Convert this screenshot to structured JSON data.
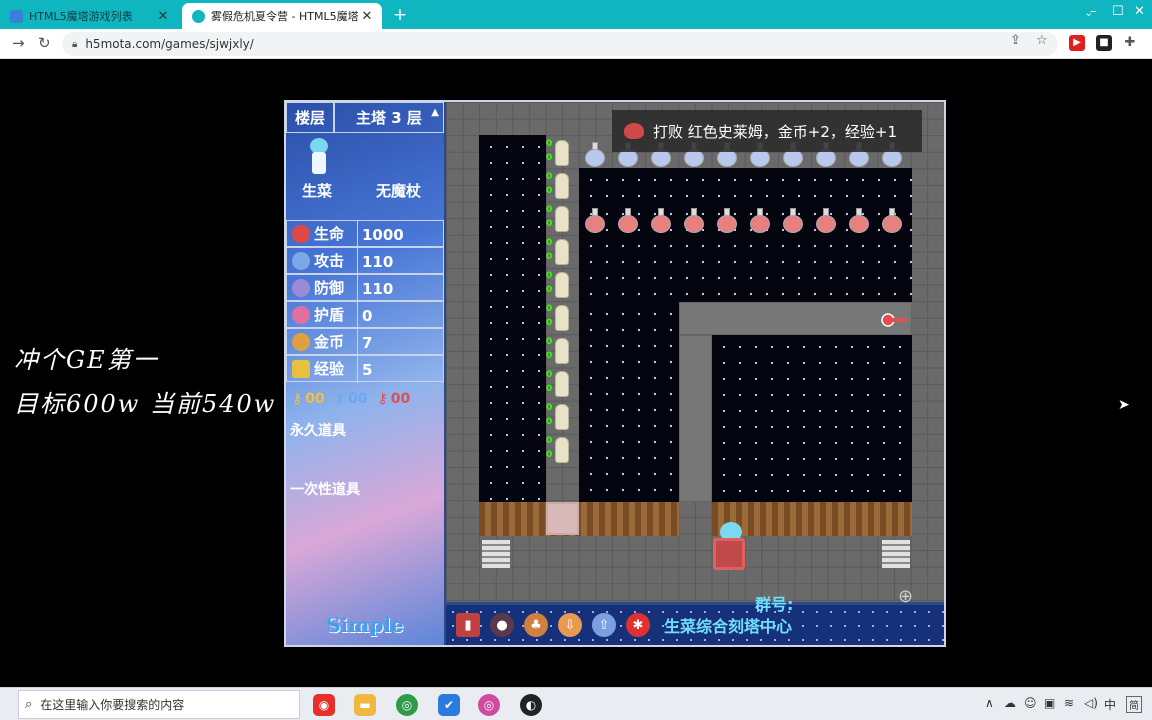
{
  "browser": {
    "tabs": [
      {
        "title": "HTML5魔塔游戏列表",
        "active": false
      },
      {
        "title": "雾假危机夏令营 - HTML5魔塔",
        "active": true
      }
    ],
    "url": "h5mota.com/games/sjwjxly/"
  },
  "overlay_text": {
    "line1": "冲个GE第一",
    "line2": "目标600w 当前540w"
  },
  "panel": {
    "floor_label": "楼层",
    "floor_value": "主塔 3 层",
    "hero_name": "生菜",
    "hero_weapon": "无魔杖",
    "stats": [
      {
        "label": "生命",
        "value": "1000",
        "icon": "heart-icon",
        "color": "#e04848"
      },
      {
        "label": "攻击",
        "value": "110",
        "icon": "sword-icon",
        "color": "#7aa8e8"
      },
      {
        "label": "防御",
        "value": "110",
        "icon": "shield-icon",
        "color": "#9a8ad8"
      },
      {
        "label": "护盾",
        "value": "0",
        "icon": "barrier-icon",
        "color": "#e070a0"
      },
      {
        "label": "金币",
        "value": "7",
        "icon": "coin-icon",
        "color": "#e0a040"
      },
      {
        "label": "经验",
        "value": "5",
        "icon": "exp-icon",
        "color": "#e8c040"
      }
    ],
    "keys": [
      {
        "count": "00",
        "color": "#f0c040",
        "icon": "yellow-key-icon"
      },
      {
        "count": "00",
        "color": "#6aa8f0",
        "icon": "blue-key-icon"
      },
      {
        "count": "00",
        "color": "#e05050",
        "icon": "red-key-icon"
      }
    ],
    "permanent_items_label": "永久道具",
    "consumable_items_label": "一次性道具",
    "mode_label": "Simple"
  },
  "map": {
    "toast": "打败 红色史莱姆，金币+2，经验+1",
    "mummy_damage": [
      "0",
      "0",
      "0",
      "0",
      "0",
      "0",
      "0",
      "0",
      "0",
      "0"
    ]
  },
  "toolbar": {
    "tools": [
      {
        "icon": "book-icon",
        "color": "#c04040",
        "glyph": "▮"
      },
      {
        "icon": "bag-icon",
        "color": "#5a3a4a",
        "glyph": "●"
      },
      {
        "icon": "pouch-icon",
        "color": "#d08040",
        "glyph": "♣"
      },
      {
        "icon": "save-icon",
        "color": "#e89a50",
        "glyph": "⇩"
      },
      {
        "icon": "load-icon",
        "color": "#7aa0e0",
        "glyph": "⇧"
      },
      {
        "icon": "settings-icon",
        "color": "#e03030",
        "glyph": "✱"
      }
    ],
    "title": "生菜综合刻塔中心"
  },
  "below_game": {
    "group_label": "群号:"
  },
  "taskbar": {
    "search_placeholder": "在这里输入你要搜索的内容",
    "tray_ime": "中",
    "tray_ime2": "简"
  }
}
